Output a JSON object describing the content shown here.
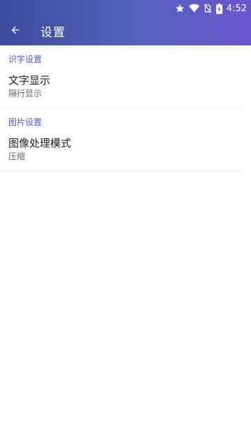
{
  "statusbar": {
    "time": "4:52",
    "icons": [
      "star-icon",
      "wifi-icon",
      "no-sim-icon",
      "battery-charging-icon"
    ]
  },
  "toolbar": {
    "title": "设置"
  },
  "sections": [
    {
      "header": "识字设置",
      "items": [
        {
          "title": "文字显示",
          "summary": "隔行显示"
        }
      ]
    },
    {
      "header": "图片设置",
      "items": [
        {
          "title": "图像处理模式",
          "summary": "压缩"
        }
      ]
    }
  ],
  "colors": {
    "header_gradient_start": "#3c4c9a",
    "header_gradient_end": "#6a56cc",
    "section_accent": "#4f57c6"
  }
}
